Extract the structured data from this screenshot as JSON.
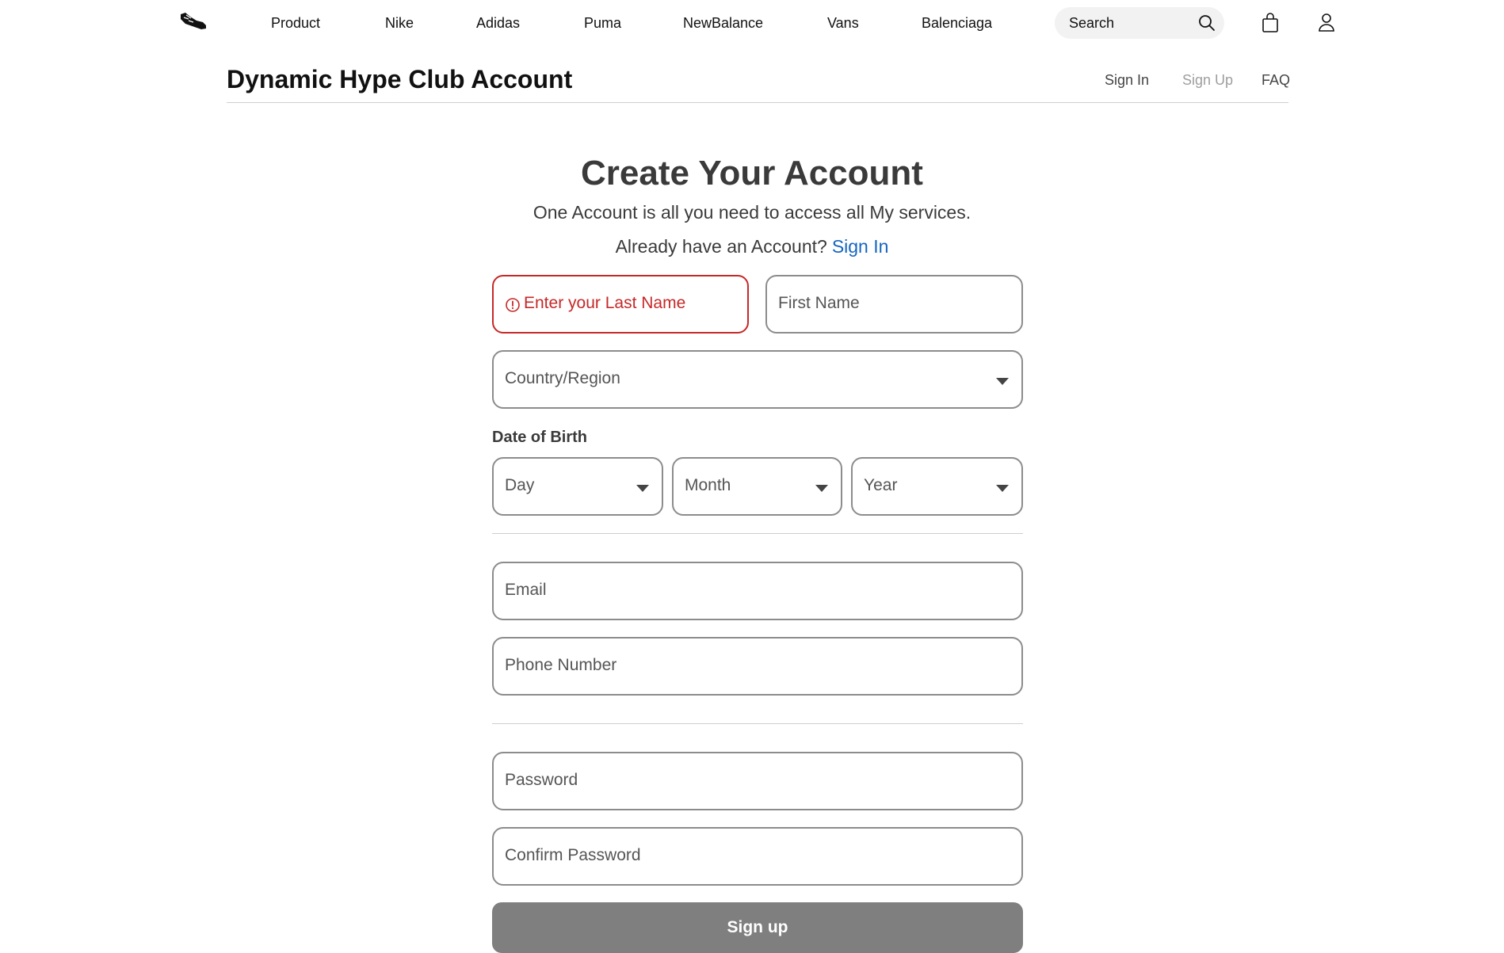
{
  "nav": {
    "items": [
      "Product",
      "Nike",
      "Adidas",
      "Puma",
      "NewBalance",
      "Vans",
      "Balenciaga"
    ],
    "search_label": "Search",
    "icons": {
      "logo": "sneaker-logo-icon",
      "search": "search-icon",
      "bag": "shopping-bag-icon",
      "user": "user-icon"
    }
  },
  "subheader": {
    "title": "Dynamic Hype Club Account",
    "links": {
      "sign_in": "Sign In",
      "sign_up": "Sign Up",
      "faq": "FAQ"
    }
  },
  "form": {
    "heading": "Create Your Account",
    "tagline": "One Account is all you need to access all My services.",
    "already_text": "Already have an Account?",
    "already_link": "Sign In",
    "last_name_error": "Enter your Last Name",
    "first_name_placeholder": "First Name",
    "country_placeholder": "Country/Region",
    "dob_label": "Date of Birth",
    "day_placeholder": "Day",
    "month_placeholder": "Month",
    "year_placeholder": "Year",
    "email_placeholder": "Email",
    "phone_placeholder": "Phone Number",
    "password_placeholder": "Password",
    "confirm_password_placeholder": "Confirm Password",
    "submit_label": "Sign up"
  },
  "colors": {
    "error": "#c62828",
    "link": "#1565c0",
    "button": "#7f7f7f",
    "muted_link": "#9e9e9e"
  }
}
